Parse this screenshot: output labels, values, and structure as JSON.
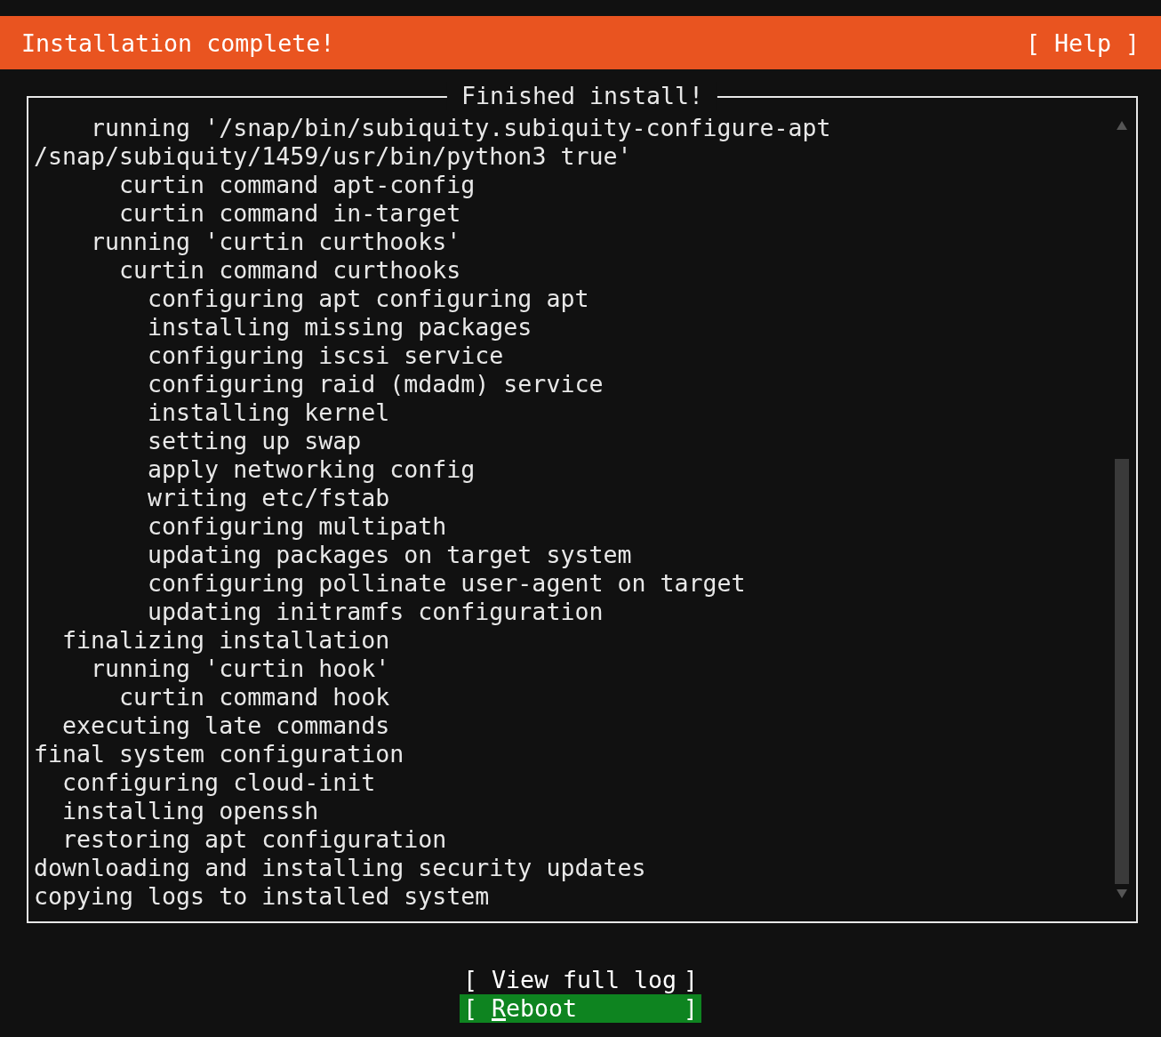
{
  "header": {
    "title": "Installation complete!",
    "help": {
      "open": "[",
      "label": "Help",
      "close": "]"
    }
  },
  "log": {
    "title": "Finished install!",
    "entries": [
      {
        "children": [
          {
            "children": [
              {
                "text": "running '/snap/bin/subiquity.subiquity-configure-apt /snap/subiquity/1459/usr/bin/python3 true'",
                "children": [
                  {
                    "text": "curtin command apt-config"
                  },
                  {
                    "text": "curtin command in-target"
                  }
                ]
              },
              {
                "text": "running 'curtin curthooks'",
                "children": [
                  {
                    "text": "curtin command curthooks",
                    "children": [
                      {
                        "text": "configuring apt configuring apt"
                      },
                      {
                        "text": "installing missing packages"
                      },
                      {
                        "text": "configuring iscsi service"
                      },
                      {
                        "text": "configuring raid (mdadm) service"
                      },
                      {
                        "text": "installing kernel"
                      },
                      {
                        "text": "setting up swap"
                      },
                      {
                        "text": "apply networking config"
                      },
                      {
                        "text": "writing etc/fstab"
                      },
                      {
                        "text": "configuring multipath"
                      },
                      {
                        "text": "updating packages on target system"
                      },
                      {
                        "text": "configuring pollinate user-agent on target"
                      },
                      {
                        "text": "updating initramfs configuration"
                      }
                    ]
                  }
                ]
              }
            ]
          },
          {
            "text": "finalizing installation",
            "children": [
              {
                "text": "running 'curtin hook'",
                "children": [
                  {
                    "text": "curtin command hook"
                  }
                ]
              }
            ]
          },
          {
            "text": "executing late commands"
          }
        ]
      },
      {
        "text": "final system configuration",
        "children": [
          {
            "text": "configuring cloud-init"
          },
          {
            "text": "installing openssh"
          },
          {
            "text": "restoring apt configuration"
          }
        ]
      },
      {
        "text": "downloading and installing security updates"
      },
      {
        "text": "copying logs to installed system"
      }
    ]
  },
  "buttons": [
    {
      "open": "[",
      "label": "View full log",
      "close": "]",
      "selected": false
    },
    {
      "open": "[",
      "label": "Reboot",
      "close": "]",
      "selected": true
    }
  ]
}
